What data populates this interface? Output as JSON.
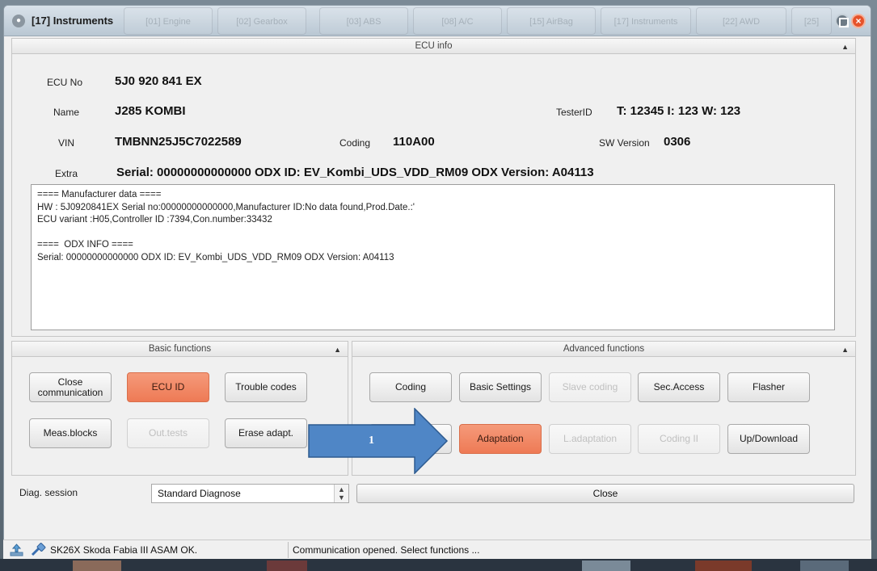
{
  "window": {
    "title": "[17] Instruments",
    "ghost_tabs": [
      "[01] Engine",
      "[02] Gearbox",
      "[03] ABS",
      "[08] A/C",
      "[15] AirBag",
      "[17] Instruments",
      "[22] AWD",
      "[25]"
    ]
  },
  "ecu_info": {
    "header": "ECU info",
    "ecu_no_label": "ECU No",
    "ecu_no": "5J0 920 841 EX",
    "name_label": "Name",
    "name": "J285  KOMBI",
    "tester_label": "TesterID",
    "tester": "T: 12345 I: 123 W: 123",
    "vin_label": "VIN",
    "vin": "TMBNN25J5C7022589",
    "coding_label": "Coding",
    "coding": "110A00",
    "sw_label": "SW Version",
    "sw": "0306",
    "extra_label": "Extra",
    "extra": "Serial: 00000000000000 ODX ID: EV_Kombi_UDS_VDD_RM09 ODX Version: A04113",
    "details": [
      "==== Manufacturer data ====",
      "HW : 5J0920841EX Serial no:00000000000000,Manufacturer ID:No data found,Prod.Date.:'",
      "ECU variant :H05,Controller ID :7394,Con.number:33432",
      "",
      "====  ODX INFO ====",
      "Serial: 00000000000000 ODX ID: EV_Kombi_UDS_VDD_RM09 ODX Version: A04113"
    ]
  },
  "basic_functions": {
    "header": "Basic functions",
    "buttons": [
      "Close communication",
      "ECU ID",
      "Trouble codes",
      "Meas.blocks",
      "Out.tests",
      "Erase adapt."
    ]
  },
  "advanced_functions": {
    "header": "Advanced functions",
    "buttons": [
      "Coding",
      "Basic Settings",
      "Slave coding",
      "Sec.Access",
      "Flasher",
      "Adaptation",
      "L.adaptation",
      "Coding II",
      "Up/Download"
    ]
  },
  "diag": {
    "label": "Diag. session",
    "value": "Standard Diagnose",
    "close_label": "Close"
  },
  "status": {
    "left": "SK26X Skoda Fabia III ASAM OK.",
    "right": "Communication opened. Select functions ..."
  },
  "annotation": {
    "number": "1"
  },
  "colors": {
    "active_button": "#ee7a55",
    "arrow_fill": "#4f86c6"
  }
}
